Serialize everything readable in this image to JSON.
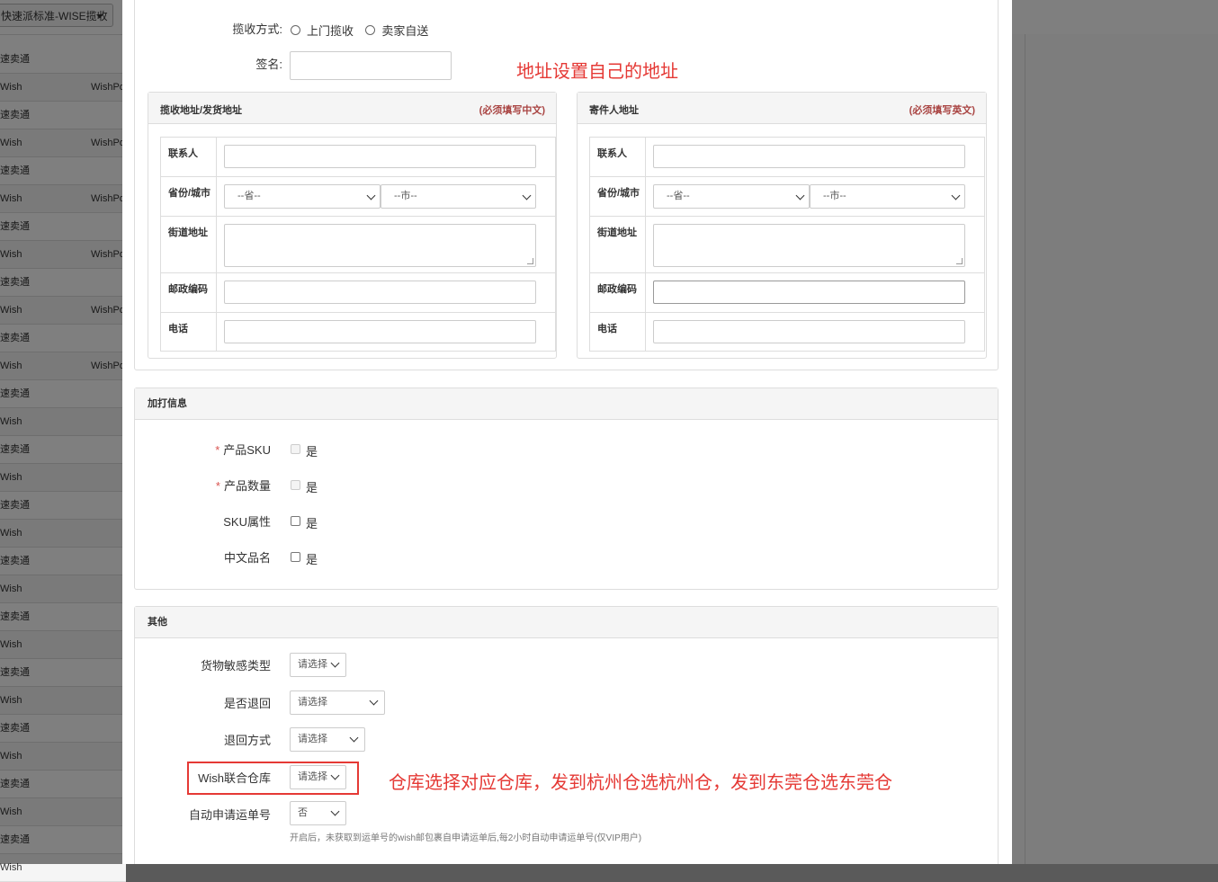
{
  "background": {
    "dropdown_label": "快速派标准-WISE揽收",
    "rows": [
      {
        "c1": "速卖通",
        "c2": ""
      },
      {
        "c1": "Wish",
        "c2": "WishPost"
      },
      {
        "c1": "速卖通",
        "c2": ""
      },
      {
        "c1": "Wish",
        "c2": "WishPost"
      },
      {
        "c1": "速卖通",
        "c2": ""
      },
      {
        "c1": "Wish",
        "c2": "WishPost"
      },
      {
        "c1": "速卖通",
        "c2": ""
      },
      {
        "c1": "Wish",
        "c2": "WishPost"
      },
      {
        "c1": "速卖通",
        "c2": ""
      },
      {
        "c1": "Wish",
        "c2": "WishPost"
      },
      {
        "c1": "速卖通",
        "c2": ""
      },
      {
        "c1": "Wish",
        "c2": "WishPost"
      },
      {
        "c1": "速卖通",
        "c2": ""
      },
      {
        "c1": "Wish",
        "c2": ""
      },
      {
        "c1": "速卖通",
        "c2": ""
      },
      {
        "c1": "Wish",
        "c2": ""
      },
      {
        "c1": "速卖通",
        "c2": ""
      },
      {
        "c1": "Wish",
        "c2": ""
      },
      {
        "c1": "速卖通",
        "c2": ""
      },
      {
        "c1": "Wish",
        "c2": ""
      },
      {
        "c1": "速卖通",
        "c2": ""
      },
      {
        "c1": "Wish",
        "c2": ""
      },
      {
        "c1": "速卖通",
        "c2": ""
      },
      {
        "c1": "Wish",
        "c2": ""
      },
      {
        "c1": "速卖通",
        "c2": ""
      },
      {
        "c1": "Wish",
        "c2": ""
      },
      {
        "c1": "速卖通",
        "c2": ""
      },
      {
        "c1": "Wish",
        "c2": ""
      },
      {
        "c1": "速卖通",
        "c2": ""
      },
      {
        "c1": "Wish",
        "c2": ""
      }
    ]
  },
  "pickup": {
    "label": "揽收方式:",
    "option1": "上门揽收",
    "option2": "卖家自送",
    "signature_label": "签名:"
  },
  "annotation_address": "地址设置自己的地址",
  "addr_left": {
    "title": "揽收地址/发货地址",
    "hint": "(必须填写中文)",
    "contact": "联系人",
    "province_city": "省份/城市",
    "province_placeholder": "--省--",
    "city_placeholder": "--市--",
    "street": "街道地址",
    "postcode": "邮政编码",
    "phone": "电话"
  },
  "addr_right": {
    "title": "寄件人地址",
    "hint": "(必须填写英文)",
    "contact": "联系人",
    "province_city": "省份/城市",
    "province_placeholder": "--省--",
    "city_placeholder": "--市--",
    "street": "街道地址",
    "postcode": "邮政编码",
    "phone": "电话"
  },
  "extra_print": {
    "title": "加打信息",
    "items": [
      {
        "label": "产品SKU",
        "required": "*",
        "check_label": "是"
      },
      {
        "label": "产品数量",
        "required": "*",
        "check_label": "是"
      },
      {
        "label": "SKU属性",
        "required": "",
        "check_label": "是"
      },
      {
        "label": "中文品名",
        "required": "",
        "check_label": "是"
      }
    ]
  },
  "other": {
    "title": "其他",
    "sensitive_label": "货物敏感类型",
    "sensitive_value": "请选择",
    "return_label": "是否退回",
    "return_value": "请选择",
    "return_method_label": "退回方式",
    "return_method_value": "请选择",
    "warehouse_label": "Wish联合仓库",
    "warehouse_value": "请选择",
    "auto_apply_label": "自动申请运单号",
    "auto_apply_value": "否",
    "auto_apply_hint": "开启后，未获取到运单号的wish邮包裹自申请运单后,每2小时自动申请运单号(仅VIP用户)"
  },
  "annotation_warehouse": "仓库选择对应仓库，发到杭州仓选杭州仓，发到东莞仓选东莞仓",
  "colors": {
    "annotation": "#e53935",
    "required": "#d9534f",
    "hint": "#a94442"
  }
}
